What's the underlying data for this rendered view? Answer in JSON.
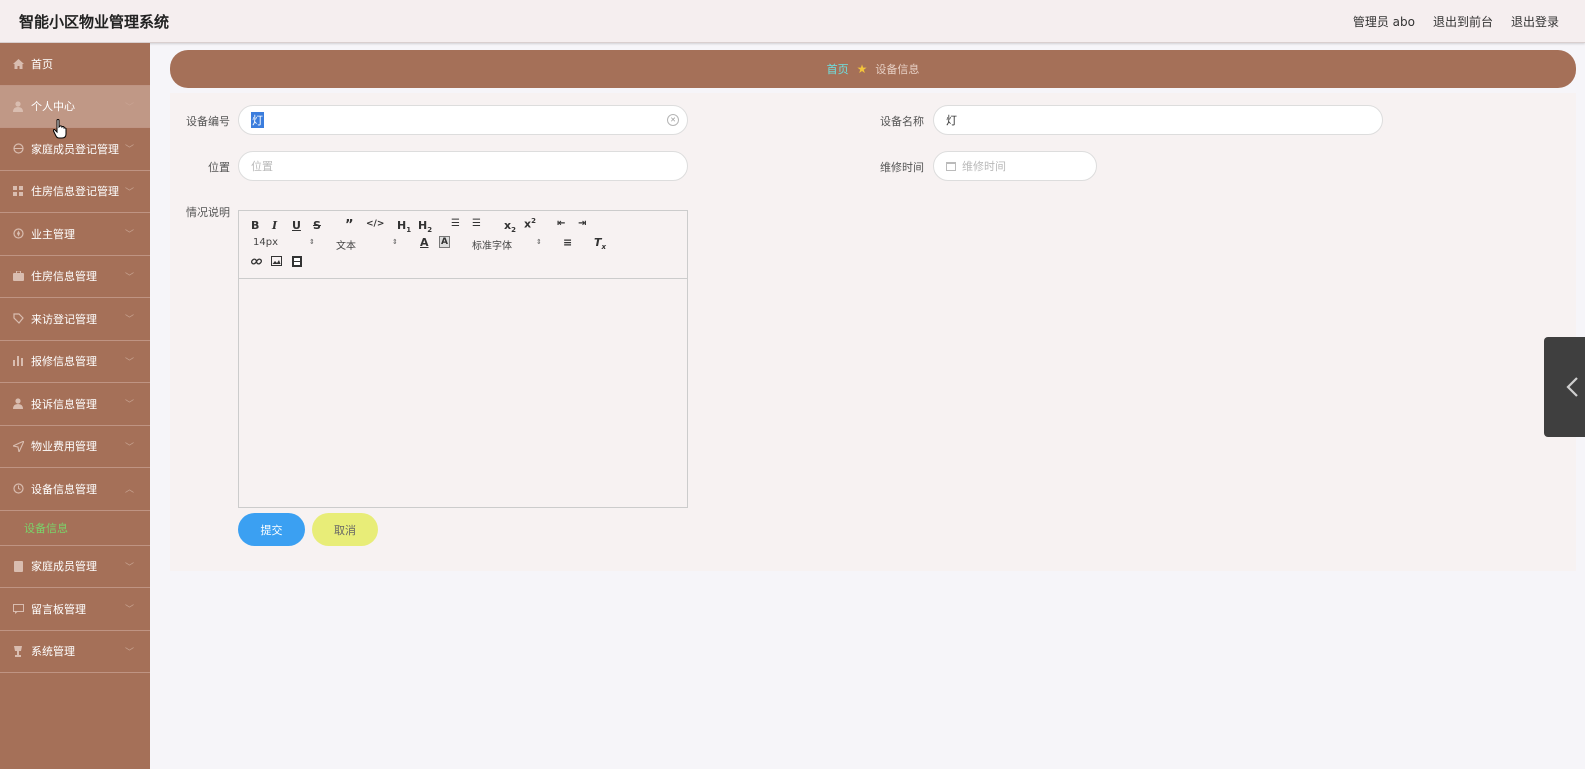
{
  "header": {
    "title": "智能小区物业管理系统",
    "user": "管理员 abo",
    "to_front": "退出到前台",
    "logout": "退出登录"
  },
  "sidebar": {
    "items": [
      {
        "label": "首页",
        "icon": "home-icon",
        "chevron": false
      },
      {
        "label": "个人中心",
        "icon": "user-icon",
        "chevron": true
      },
      {
        "label": "家庭成员登记管理",
        "icon": "globe-icon",
        "chevron": true
      },
      {
        "label": "住房信息登记管理",
        "icon": "grid-icon",
        "chevron": true
      },
      {
        "label": "业主管理",
        "icon": "compass-icon",
        "chevron": true
      },
      {
        "label": "住房信息管理",
        "icon": "briefcase-icon",
        "chevron": true
      },
      {
        "label": "来访登记管理",
        "icon": "tag-icon",
        "chevron": true
      },
      {
        "label": "报修信息管理",
        "icon": "bar-chart-icon",
        "chevron": true
      },
      {
        "label": "投诉信息管理",
        "icon": "person-icon",
        "chevron": true
      },
      {
        "label": "物业费用管理",
        "icon": "send-icon",
        "chevron": true
      },
      {
        "label": "设备信息管理",
        "icon": "clock-icon",
        "chevron": true
      }
    ],
    "sub_item": "设备信息",
    "items_after": [
      {
        "label": "家庭成员管理",
        "icon": "doc-icon"
      },
      {
        "label": "留言板管理",
        "icon": "message-icon"
      },
      {
        "label": "系统管理",
        "icon": "trophy-icon"
      }
    ]
  },
  "breadcrumb": {
    "home": "首页",
    "current": "设备信息"
  },
  "form": {
    "device_no_label": "设备编号",
    "device_no_value": "灯",
    "device_name_label": "设备名称",
    "device_name_value": "灯",
    "location_label": "位置",
    "location_placeholder": "位置",
    "repair_time_label": "维修时间",
    "repair_time_placeholder": "维修时间",
    "description_label": "情况说明"
  },
  "editor": {
    "font_size": "14px",
    "block_type": "文本",
    "font_family": "标准字体"
  },
  "buttons": {
    "submit": "提交",
    "cancel": "取消"
  },
  "colors": {
    "sidebar": "#a57058",
    "submit": "#3ba0f2",
    "cancel": "#e8ed78",
    "sub_active": "#7ad36a"
  }
}
